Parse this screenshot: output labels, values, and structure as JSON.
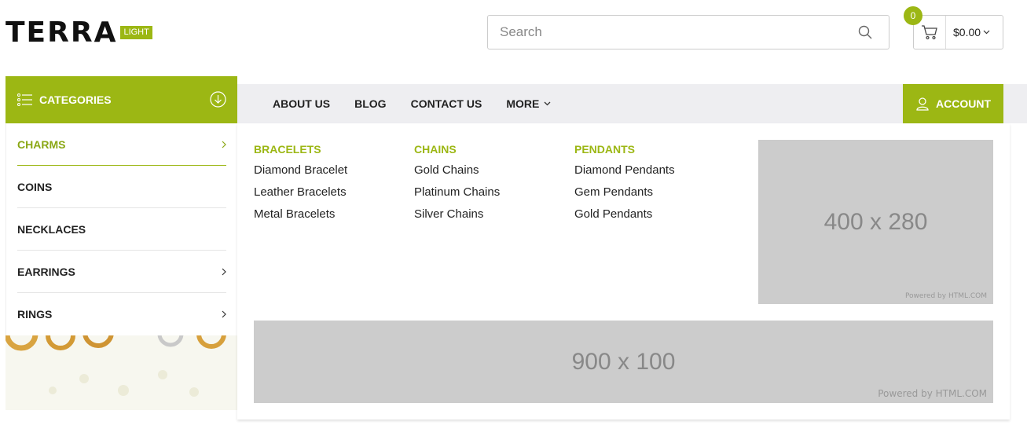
{
  "header": {
    "logo": {
      "name": "TERRA",
      "badge": "LIGHT"
    },
    "search": {
      "placeholder": "Search",
      "value": ""
    },
    "cart": {
      "count": "0",
      "amount": "$0.00"
    }
  },
  "nav": {
    "items": [
      {
        "label": "ABOUT US"
      },
      {
        "label": "BLOG"
      },
      {
        "label": "CONTACT US"
      },
      {
        "label": "MORE"
      }
    ],
    "account_label": "ACCOUNT"
  },
  "categories": {
    "title": "CATEGORIES",
    "items": [
      {
        "label": "CHARMS"
      },
      {
        "label": "COINS"
      },
      {
        "label": "NECKLACES"
      },
      {
        "label": "EARRINGS"
      },
      {
        "label": "RINGS"
      }
    ]
  },
  "mega_menu": {
    "columns": [
      {
        "title": "BRACELETS",
        "links": [
          "Diamond Bracelet",
          "Leather Bracelets",
          "Metal Bracelets"
        ]
      },
      {
        "title": "CHAINS",
        "links": [
          "Gold Chains",
          "Platinum Chains",
          "Silver Chains"
        ]
      },
      {
        "title": "PENDANTS",
        "links": [
          "Diamond Pendants",
          "Gem Pendants",
          "Gold Pendants"
        ]
      }
    ],
    "image_side": {
      "text": "400 x 280",
      "powered": "Powered by HTML.COM"
    },
    "image_wide": {
      "text": "900 x 100",
      "powered": "Powered by HTML.COM"
    }
  },
  "colors": {
    "accent": "#9cb714",
    "nav_bg": "#eeeef1",
    "placeholder_bg": "#cccccc"
  }
}
